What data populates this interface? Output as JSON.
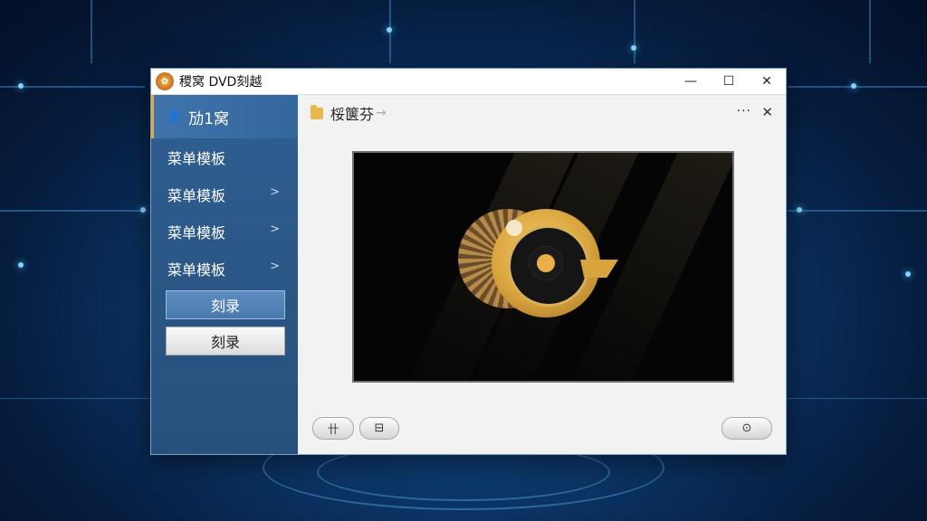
{
  "window": {
    "title": "稷窝 DVD刻越",
    "controls": {
      "minimize": "—",
      "maximize": "☐",
      "close": "✕"
    }
  },
  "sidebar": {
    "header": "劢1窝",
    "items": [
      {
        "label": "菜单模板",
        "has_submenu": false
      },
      {
        "label": "菜单模板",
        "has_submenu": true
      },
      {
        "label": "菜单模板",
        "has_submenu": true
      },
      {
        "label": "菜单模板",
        "has_submenu": true
      }
    ],
    "burn_buttons": [
      "刻录",
      "刻录"
    ]
  },
  "main": {
    "title": "桵箧芬",
    "more": "···",
    "close": "✕"
  },
  "toolbar": {
    "grid_glyph": "卄",
    "film_glyph": "⊟",
    "disc_glyph": "⊙"
  },
  "colors": {
    "sidebar": "#2b5786",
    "accent": "#e0a84a",
    "preview_bg": "#050505",
    "logo_gold": "#d9a43d"
  }
}
